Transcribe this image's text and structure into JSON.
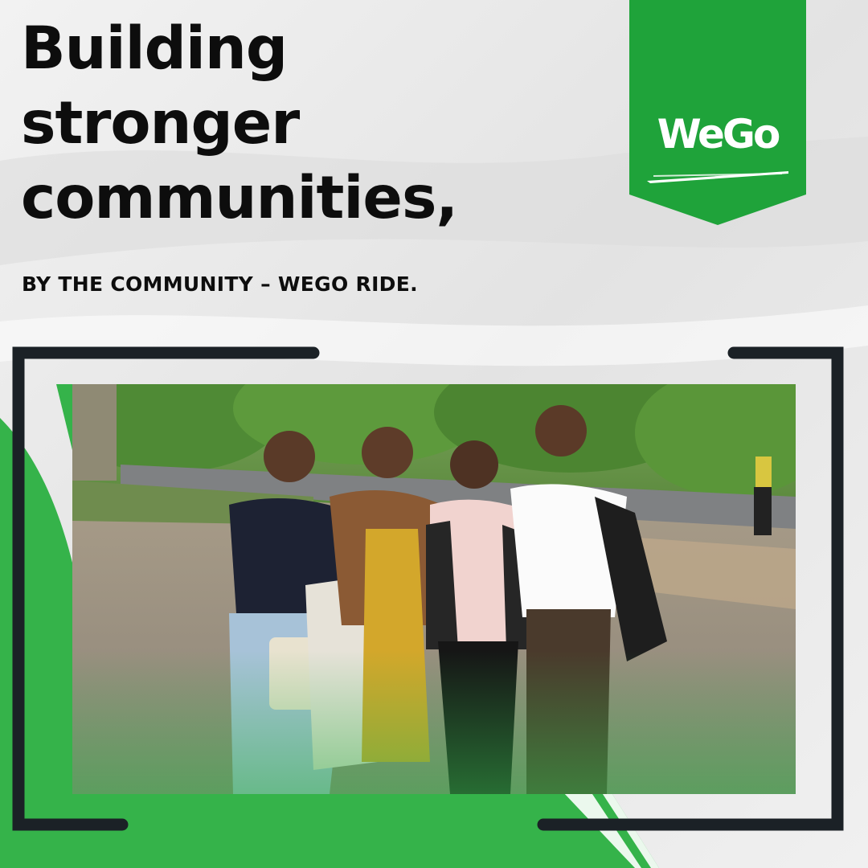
{
  "headline": {
    "line1": "Building",
    "line2": "stronger",
    "line3": "communities,"
  },
  "tagline": "BY THE COMMUNITY – WEGO RIDE.",
  "brand": {
    "logo_text": "WeGo",
    "green": "#1fa33a",
    "accent_green": "#35b34a",
    "dark": "#1b2126"
  },
  "photo": {
    "subject": "group-photo"
  }
}
